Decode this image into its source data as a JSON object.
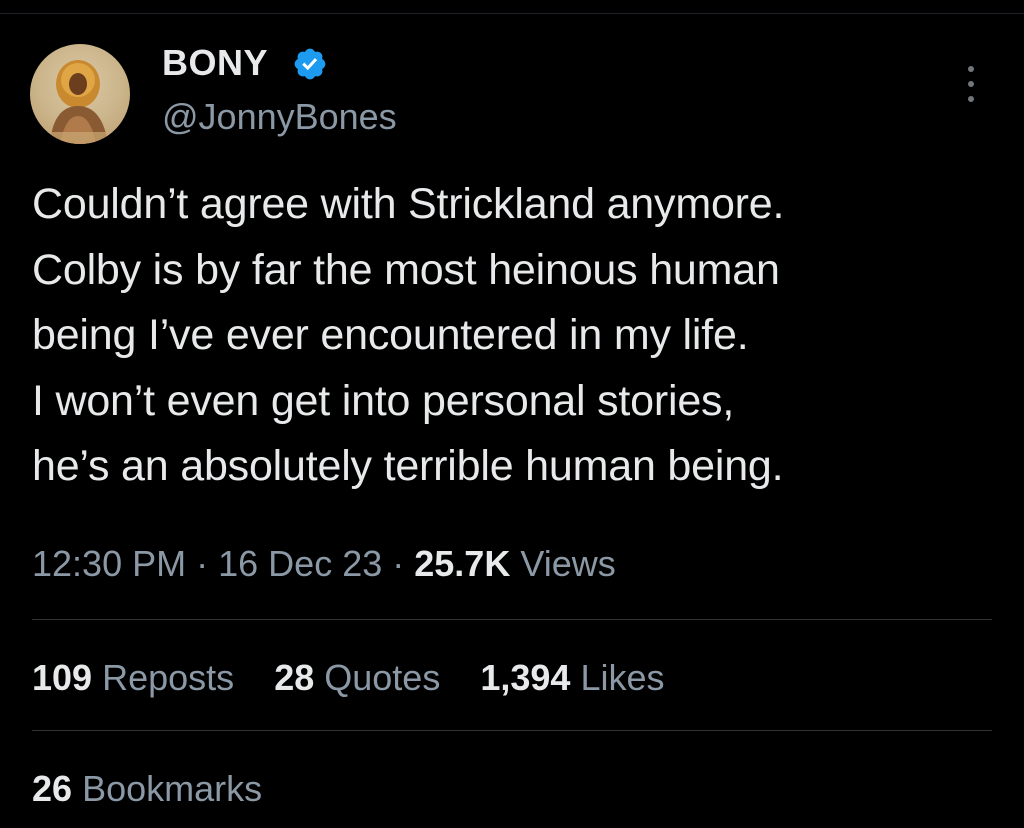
{
  "tweet": {
    "author": {
      "display_name": "BONY",
      "handle": "@JonnyBones",
      "verified": true,
      "verified_color": "#1d9bf0"
    },
    "text_lines": [
      "Couldn’t agree with Strickland anymore.",
      "Colby is by far the most heinous human",
      "being I’ve ever encountered in my life.",
      "I won’t even get into personal stories,",
      "he’s an absolutely terrible human being."
    ],
    "meta": {
      "time": "12:30 PM",
      "separator": "·",
      "date": "16 Dec 23",
      "views_count": "25.7K",
      "views_label": "Views"
    },
    "stats": {
      "reposts_count": "109",
      "reposts_label": "Reposts",
      "quotes_count": "28",
      "quotes_label": "Quotes",
      "likes_count": "1,394",
      "likes_label": "Likes",
      "bookmarks_count": "26",
      "bookmarks_label": "Bookmarks"
    },
    "icons": {
      "avatar": "profile-avatar",
      "verified": "verified-badge-icon",
      "more": "more-options-icon"
    }
  }
}
